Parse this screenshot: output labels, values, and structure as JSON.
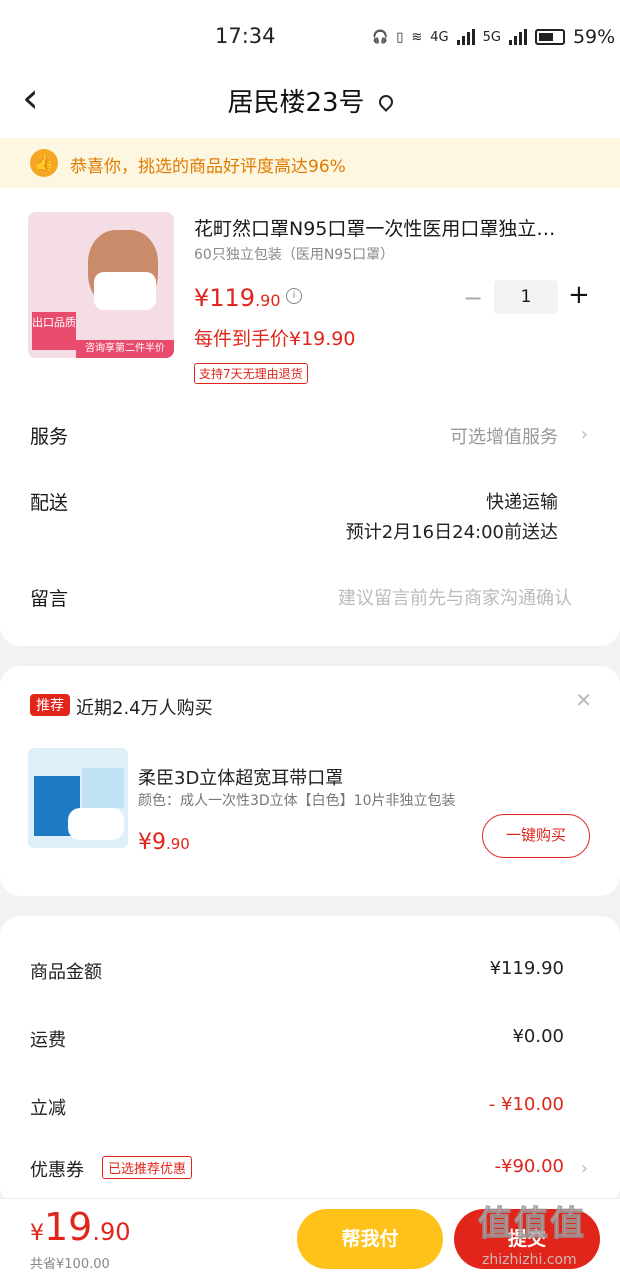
{
  "status_bar": {
    "time": "17:34",
    "network_4g": "4G",
    "network_5g": "5G",
    "battery": "59%"
  },
  "nav": {
    "title": "居民楼23号"
  },
  "banner": {
    "text": "恭喜你，挑选的商品好评度高达96%"
  },
  "product": {
    "image_tag": "出口品质",
    "image_strip": "咨询享第二件半价",
    "title": "花町然口罩N95口罩一次性医用口罩独立…",
    "subtitle": "60只独立包装（医用N95口罩）",
    "price_main": "¥119",
    "price_decimal": ".90",
    "quantity": "1",
    "final_price": "每件到手价¥19.90",
    "return_tag": "支持7天无理由退货"
  },
  "rows": {
    "service_label": "服务",
    "service_value": "可选增值服务",
    "delivery_label": "配送",
    "delivery_method": "快递运输",
    "delivery_eta": "预计2月16日24:00前送达",
    "message_label": "留言",
    "message_placeholder": "建议留言前先与商家沟通确认"
  },
  "recommend": {
    "badge": "推荐",
    "headline": "近期2.4万人购买",
    "title": "柔臣3D立体超宽耳带口罩",
    "subtitle": "颜色：成人一次性3D立体【白色】10片非独立包装",
    "price_main": "¥9",
    "price_decimal": ".90",
    "buy_label": "一键购买"
  },
  "summary": {
    "goods_label": "商品金额",
    "goods_value": "¥119.90",
    "freight_label": "运费",
    "freight_value": "¥0.00",
    "discount_label": "立减",
    "discount_value": "- ¥10.00",
    "coupon_label": "优惠券",
    "coupon_tag": "已选推荐优惠",
    "coupon_value": "-¥90.00"
  },
  "bottom": {
    "total_yen": "¥",
    "total_main": "19",
    "total_decimal": ".90",
    "saved": "共省¥100.00",
    "help_pay": "帮我付",
    "submit": "提交"
  },
  "watermark": {
    "big": "值值值",
    "small": "zhizhizhi.com"
  },
  "colors": {
    "accent": "#e1251b",
    "help_button": "#ffc21a",
    "banner_bg": "#fdf6e1"
  }
}
